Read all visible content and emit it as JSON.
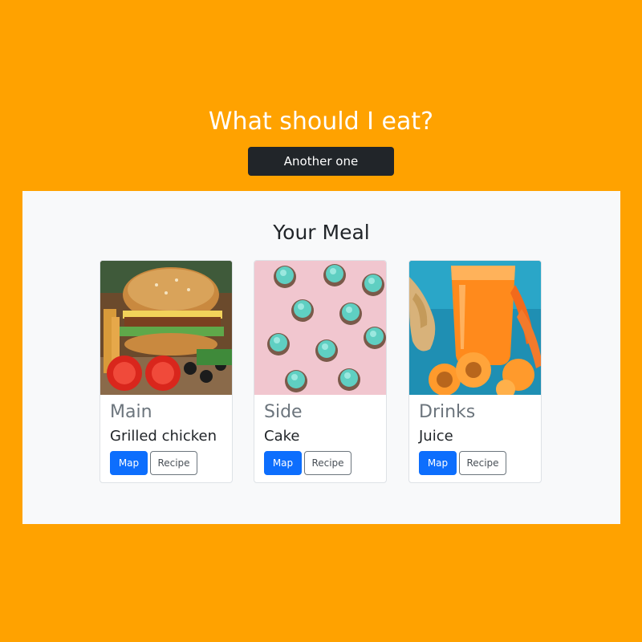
{
  "header": {
    "title": "What should I eat?",
    "another_button_label": "Another one"
  },
  "meal": {
    "title": "Your Meal",
    "cards": [
      {
        "category": "Main",
        "item": "Grilled chicken",
        "image": "burger-photo",
        "map_label": "Map",
        "recipe_label": "Recipe"
      },
      {
        "category": "Side",
        "item": "Cake",
        "image": "cupcakes-photo",
        "map_label": "Map",
        "recipe_label": "Recipe"
      },
      {
        "category": "Drinks",
        "item": "Juice",
        "image": "juice-photo",
        "map_label": "Map",
        "recipe_label": "Recipe"
      }
    ]
  },
  "colors": {
    "background": "#ffa200",
    "panel": "#f8f9fa",
    "primary_button": "#0d6efd",
    "dark_button": "#212529"
  }
}
